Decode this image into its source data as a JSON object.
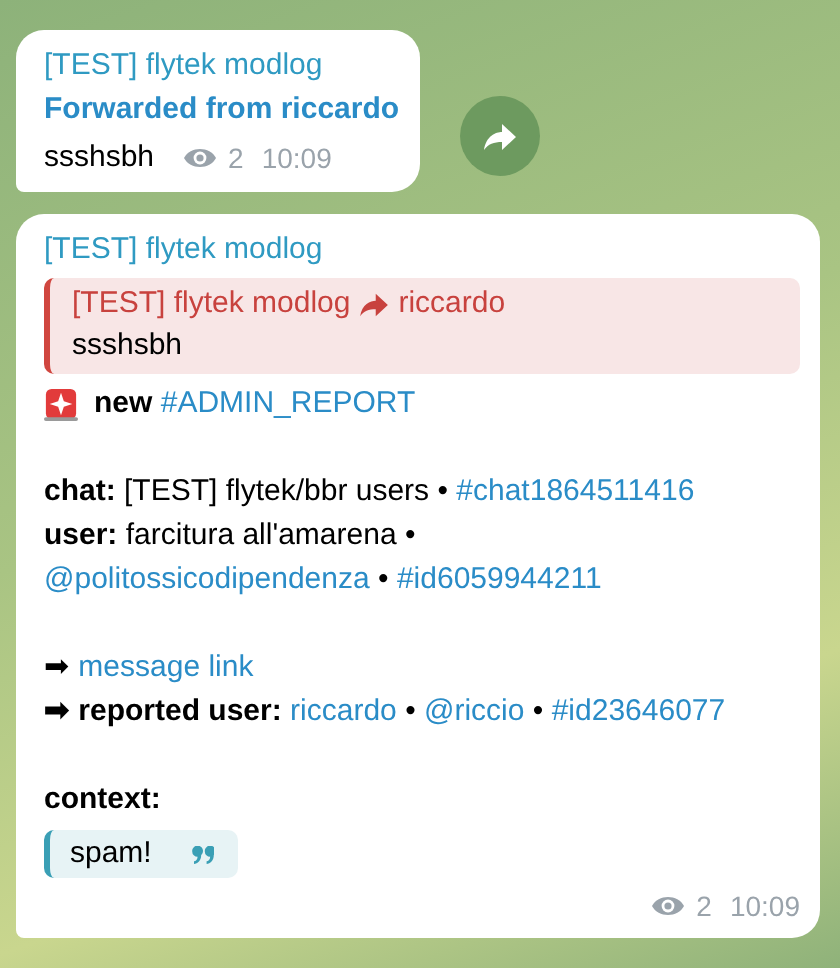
{
  "messages": [
    {
      "sender": "[TEST] flytek modlog",
      "forwarded_from": "Forwarded from riccardo",
      "text": "ssshsbh",
      "views": "2",
      "time": "10:09",
      "share_button": true
    },
    {
      "sender": "[TEST] flytek modlog",
      "reply": {
        "author": "[TEST] flytek modlog",
        "to": "riccardo",
        "text": "ssshsbh"
      },
      "lines": [
        {
          "kind": "siren",
          "segments": [
            {
              "kind": "bold",
              "text": "new"
            },
            {
              "kind": "link",
              "text": "#ADMIN_REPORT"
            }
          ]
        },
        {
          "kind": "blank"
        },
        {
          "kind": "text",
          "segments": [
            {
              "kind": "bold",
              "text": "chat:"
            },
            {
              "kind": "plain",
              "text": "[TEST] flytek/bbr users •"
            },
            {
              "kind": "link",
              "text": "#chat1864511416"
            }
          ]
        },
        {
          "kind": "text",
          "segments": [
            {
              "kind": "bold",
              "text": "user:"
            },
            {
              "kind": "plain",
              "text": "farcitura all'amarena •"
            }
          ]
        },
        {
          "kind": "text",
          "segments": [
            {
              "kind": "link",
              "text": "@politossicodipendenza"
            },
            {
              "kind": "plain",
              "text": "•"
            },
            {
              "kind": "link",
              "text": "#id6059944211"
            }
          ]
        },
        {
          "kind": "blank"
        },
        {
          "kind": "text",
          "segments": [
            {
              "kind": "plain",
              "text": "➡"
            },
            {
              "kind": "link",
              "text": "message link"
            }
          ]
        },
        {
          "kind": "text",
          "segments": [
            {
              "kind": "bold",
              "text": "➡ reported user:"
            },
            {
              "kind": "link",
              "text": "riccardo"
            },
            {
              "kind": "plain",
              "text": "•"
            },
            {
              "kind": "link",
              "text": "@riccio"
            },
            {
              "kind": "plain",
              "text": "•"
            },
            {
              "kind": "link",
              "text": "#id23646077"
            }
          ]
        },
        {
          "kind": "blank"
        },
        {
          "kind": "text",
          "segments": [
            {
              "kind": "bold",
              "text": "context:"
            }
          ]
        },
        {
          "kind": "quote",
          "text": "spam!"
        }
      ],
      "views": "2",
      "time": "10:09",
      "share_button": false
    }
  ]
}
